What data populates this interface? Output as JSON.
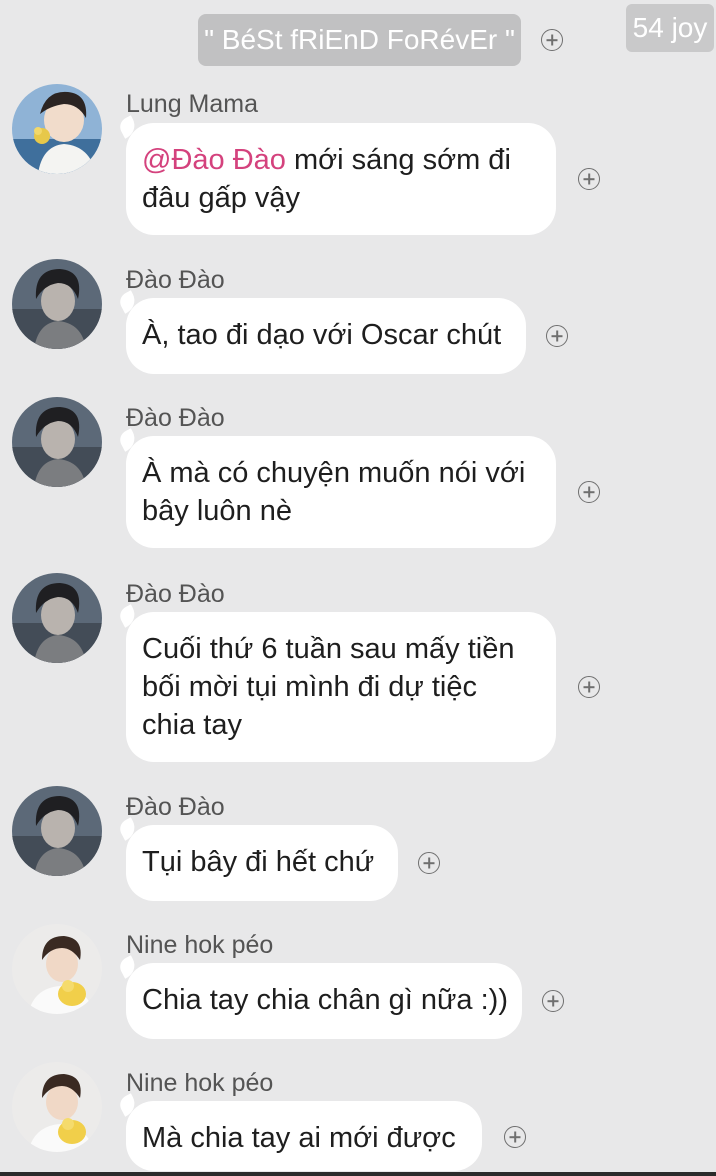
{
  "header": {
    "group_name": "\" BéSt fRiEnD FoRévEr \"",
    "counter_badge": "54 joy"
  },
  "messages": [
    {
      "sender": "Lung Mama",
      "mention": "@Đào Đào",
      "lines": [
        " mới sáng sớm đi",
        "đâu gấp vậy"
      ]
    },
    {
      "sender": "Đào Đào",
      "lines": [
        "À, tao đi dạo với Oscar chút"
      ]
    },
    {
      "sender": "Đào Đào",
      "lines": [
        "À mà có chuyện muốn nói với",
        "bây luôn nè"
      ]
    },
    {
      "sender": "Đào Đào",
      "lines": [
        "Cuối thứ 6 tuần sau mấy tiền",
        "bối mời tụi mình đi dự tiệc",
        "chia tay"
      ]
    },
    {
      "sender": "Đào Đào",
      "lines": [
        "Tụi bây đi hết chứ"
      ]
    },
    {
      "sender": "Nine hok péo",
      "lines": [
        "Chia tay chia chân gì nữa :))"
      ]
    },
    {
      "sender": "Nine hok péo",
      "lines": [
        "Mà chia tay ai mới được"
      ]
    }
  ],
  "icons": {
    "group_action": "plus-circle-icon",
    "message_reaction": "plus-circle-icon"
  },
  "colors": {
    "background": "#e8e8e9",
    "bubble": "#ffffff",
    "mention": "#d4427d",
    "group_pill": "#c1c1c2"
  }
}
